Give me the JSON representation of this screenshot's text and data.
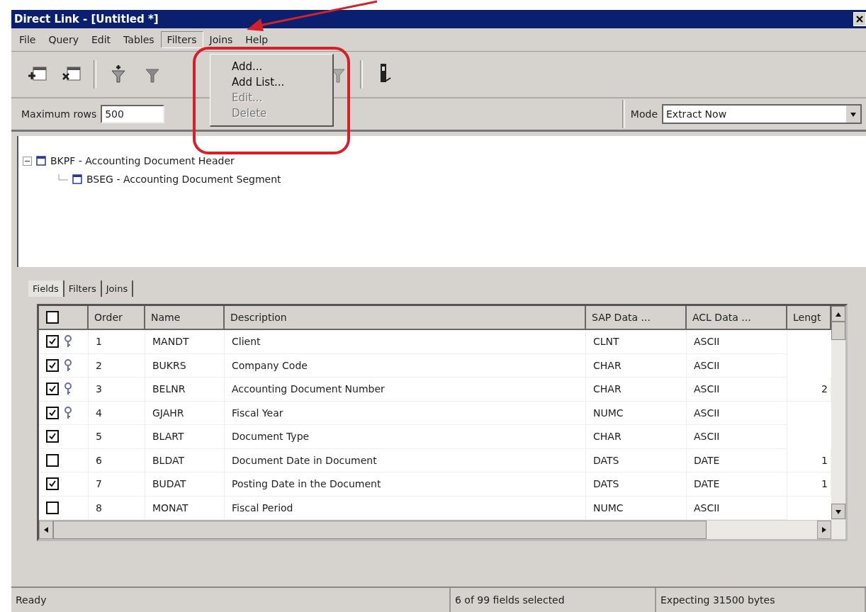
{
  "window": {
    "title": "Direct Link - [Untitled *]"
  },
  "menu_bar": [
    {
      "label": "File",
      "selected": false
    },
    {
      "label": "Query",
      "selected": false
    },
    {
      "label": "Edit",
      "selected": false
    },
    {
      "label": "Tables",
      "selected": false
    },
    {
      "label": "Filters",
      "selected": true
    },
    {
      "label": "Joins",
      "selected": false
    },
    {
      "label": "Help",
      "selected": false
    }
  ],
  "open_menu": {
    "items": [
      {
        "label": "Add...",
        "disabled": false
      },
      {
        "label": "Add List...",
        "disabled": false
      },
      {
        "label": "Edit...",
        "disabled": true
      },
      {
        "label": "Delete",
        "disabled": true
      }
    ]
  },
  "options_bar": {
    "max_rows_label": "Maximum rows",
    "max_rows_value": "500",
    "mode_label": "Mode",
    "mode_value": "Extract Now"
  },
  "tree": [
    {
      "label": "BKPF - Accounting Document Header",
      "expanded": true,
      "children": [
        {
          "label": "BSEG - Accounting Document Segment"
        }
      ]
    }
  ],
  "tabs": [
    {
      "label": "Fields",
      "selected": true
    },
    {
      "label": "Filters",
      "selected": false
    },
    {
      "label": "Joins",
      "selected": false
    }
  ],
  "table": {
    "all_checked": false,
    "columns": [
      "Order",
      "Name",
      "Description",
      "SAP Data ...",
      "ACL Data ...",
      "Lengt"
    ],
    "rows": [
      {
        "checked": true,
        "key": true,
        "order": "1",
        "name": "MANDT",
        "description": "Client",
        "sap_type": "CLNT",
        "acl_type": "ASCII"
      },
      {
        "checked": true,
        "key": true,
        "order": "2",
        "name": "BUKRS",
        "description": "Company Code",
        "sap_type": "CHAR",
        "acl_type": "ASCII"
      },
      {
        "checked": true,
        "key": true,
        "order": "3",
        "name": "BELNR",
        "description": "Accounting Document Number",
        "sap_type": "CHAR",
        "acl_type": "ASCII",
        "length": "2"
      },
      {
        "checked": true,
        "key": true,
        "order": "4",
        "name": "GJAHR",
        "description": "Fiscal Year",
        "sap_type": "NUMC",
        "acl_type": "ASCII"
      },
      {
        "checked": true,
        "key": false,
        "order": "5",
        "name": "BLART",
        "description": "Document Type",
        "sap_type": "CHAR",
        "acl_type": "ASCII"
      },
      {
        "checked": false,
        "key": false,
        "order": "6",
        "name": "BLDAT",
        "description": "Document Date in Document",
        "sap_type": "DATS",
        "acl_type": "DATE",
        "length": "1"
      },
      {
        "checked": true,
        "key": false,
        "order": "7",
        "name": "BUDAT",
        "description": "Posting Date in the Document",
        "sap_type": "DATS",
        "acl_type": "DATE",
        "length": "1"
      },
      {
        "checked": false,
        "key": false,
        "order": "8",
        "name": "MONAT",
        "description": "Fiscal Period",
        "sap_type": "NUMC",
        "acl_type": "ASCII"
      }
    ]
  },
  "status_bar": [
    "Ready",
    "6 of 99 fields selected",
    "Expecting 31500 bytes"
  ],
  "annotations": {
    "arrow": true,
    "ring": true
  }
}
